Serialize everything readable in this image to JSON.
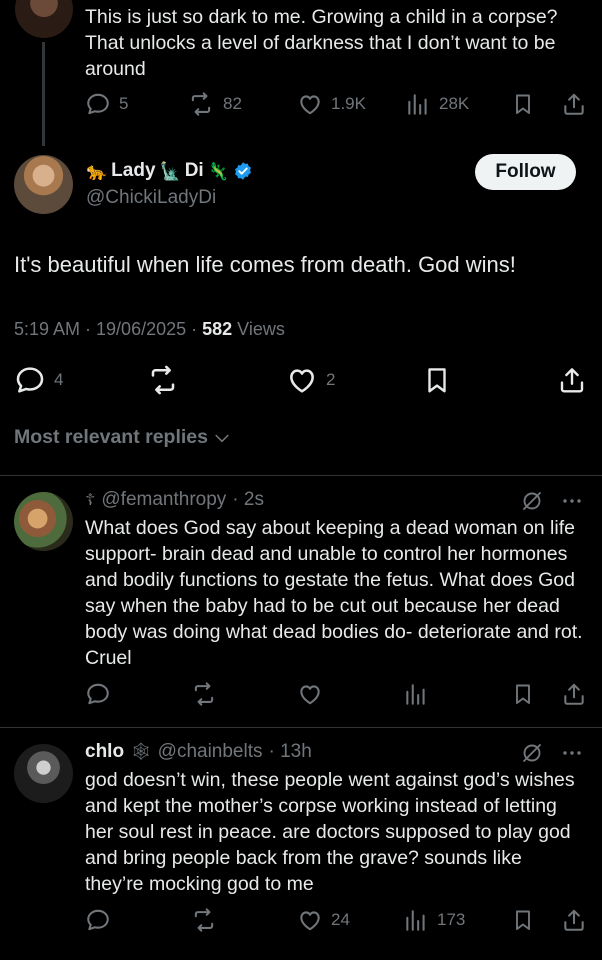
{
  "parent_tweet": {
    "text": "This is just so dark to me. Growing a child in a corpse? That unlocks a level of darkness that I don’t want to be around",
    "replies": "5",
    "reposts": "82",
    "likes": "1.9K",
    "views": "28K"
  },
  "main_tweet": {
    "display_name": "Lady",
    "display_name_2": "Di",
    "name_emoji_1": "🐆",
    "name_emoji_2": "🗽",
    "name_emoji_3": "🦎",
    "handle": "@ChickiLadyDi",
    "follow_label": "Follow",
    "text": "It's beautiful when life comes from death. God wins!",
    "time": "5:19 AM · 19/06/2025 · ",
    "views_count": "582",
    "views_label": " Views",
    "replies": "4",
    "likes": "2"
  },
  "sort": {
    "label": "Most relevant replies"
  },
  "replies": [
    {
      "name_glyph": "☦",
      "handle": "@femanthropy",
      "time": "· 2s",
      "text": "What does God say about keeping a dead woman on life support- brain dead and unable to control her hormones and bodily functions to gestate the fetus. What does God say when the baby had to be cut out because her dead body was doing what dead bodies do- deteriorate and rot. Cruel"
    },
    {
      "name": "chlo",
      "name_glyph": "🕸",
      "handle": "@chainbelts",
      "time": "· 13h",
      "text": "god doesn’t win, these people went against god’s wishes and kept the mother’s corpse working instead of letting her soul rest in peace. are doctors supposed to play god and bring people back from the grave? sounds like they’re mocking god to me",
      "likes": "24",
      "views": "173"
    }
  ],
  "colors": {
    "background": "#000000",
    "text": "#e7e9ea",
    "muted": "#71767b",
    "divider": "#2f3336",
    "verified": "#1d9bf0"
  }
}
